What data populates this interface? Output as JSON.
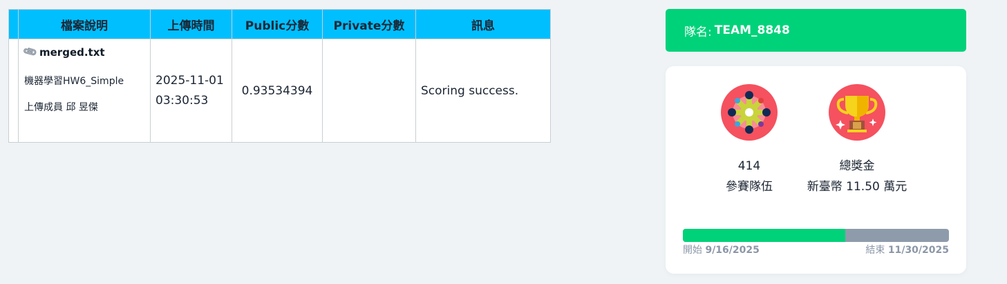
{
  "table": {
    "headers": {
      "file": "檔案說明",
      "time": "上傳時間",
      "public": "Public分數",
      "private": "Private分數",
      "message": "訊息"
    },
    "rows": [
      {
        "file_name": "merged.txt",
        "description": "機器學習HW6_Simple",
        "uploader": "上傳成員 邱 昱傑",
        "upload_date": "2025-11-01",
        "upload_time": "03:30:53",
        "public_score": "0.93534394",
        "private_score": "",
        "message": "Scoring success."
      }
    ]
  },
  "team": {
    "label": "隊名:",
    "name": "TEAM_8848"
  },
  "stats": {
    "teams_count": "414",
    "teams_label": "參賽隊伍",
    "prize_label": "總獎金",
    "prize_value": "新臺幣 11.50 萬元"
  },
  "progress": {
    "fraction": 0.61,
    "start_label": "開始",
    "start_date": "9/16/2025",
    "end_label": "結束",
    "end_date": "11/30/2025"
  },
  "colors": {
    "header_bg": "#00bfff",
    "accent_green": "#00d27a",
    "progress_track": "#8e9bab",
    "icon_red": "#f5515f"
  },
  "icons": {
    "attachment": "paperclip-icon",
    "teams": "teams-circle-icon",
    "prize": "trophy-icon"
  }
}
